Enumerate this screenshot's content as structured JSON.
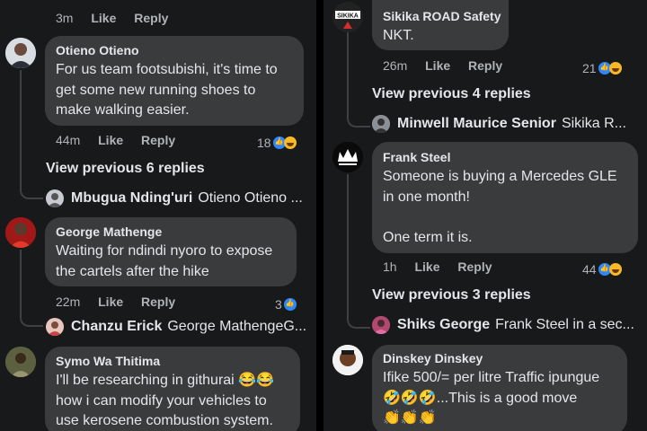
{
  "left": {
    "top_meta": {
      "time": "3m",
      "like": "Like",
      "reply": "Reply"
    },
    "c1": {
      "name": "Otieno Otieno",
      "lines": [
        "For us team footsubishi, it's time to",
        "get some new running shoes to",
        "make walking easier."
      ],
      "time": "44m",
      "like": "Like",
      "reply": "Reply",
      "count": "18"
    },
    "vp1": "View previous 6 replies",
    "r1": {
      "name": "Mbugua Nding'uri",
      "preview": "Otieno Otieno ..."
    },
    "c2": {
      "name": "George Mathenge",
      "lines": [
        "Waiting for ndindi nyoro to expose",
        "the cartels after the hike"
      ],
      "time": "22m",
      "like": "Like",
      "reply": "Reply",
      "count": "3"
    },
    "r2": {
      "name": "Chanzu Erick",
      "preview": "George MathengeG..."
    },
    "c3": {
      "name": "Symo Wa Thitima",
      "line1": "I'll be researching in githurai",
      "line1_emoji": "😂😂",
      "lines": [
        "how i can modify your vehicles to",
        "use kerosene combustion system."
      ]
    }
  },
  "right": {
    "c1": {
      "name": "Sikika ROAD Safety",
      "avatar_label": "SIKIKA",
      "text": "NKT.",
      "time": "26m",
      "like": "Like",
      "reply": "Reply",
      "count": "21"
    },
    "vp1": "View previous 4 replies",
    "r1": {
      "name": "Minwell Maurice Senior",
      "preview": "Sikika R..."
    },
    "c2": {
      "name": "Frank Steel",
      "lines": [
        "Someone is buying  a Mercedes GLE",
        "in one month!",
        "",
        "One term it is."
      ],
      "time": "1h",
      "like": "Like",
      "reply": "Reply",
      "count": "44"
    },
    "vp2": "View previous 3 replies",
    "r2": {
      "name": "Shiks George",
      "preview": "Frank Steel in a sec..."
    },
    "c3": {
      "name": "Dinskey Dinskey",
      "line1": "Ifike 500/= per litre Traffic ipungue",
      "line2_emoji": "🤣🤣🤣",
      "line2_text": "...This is a good move",
      "line3_emoji": "👏👏👏"
    }
  }
}
